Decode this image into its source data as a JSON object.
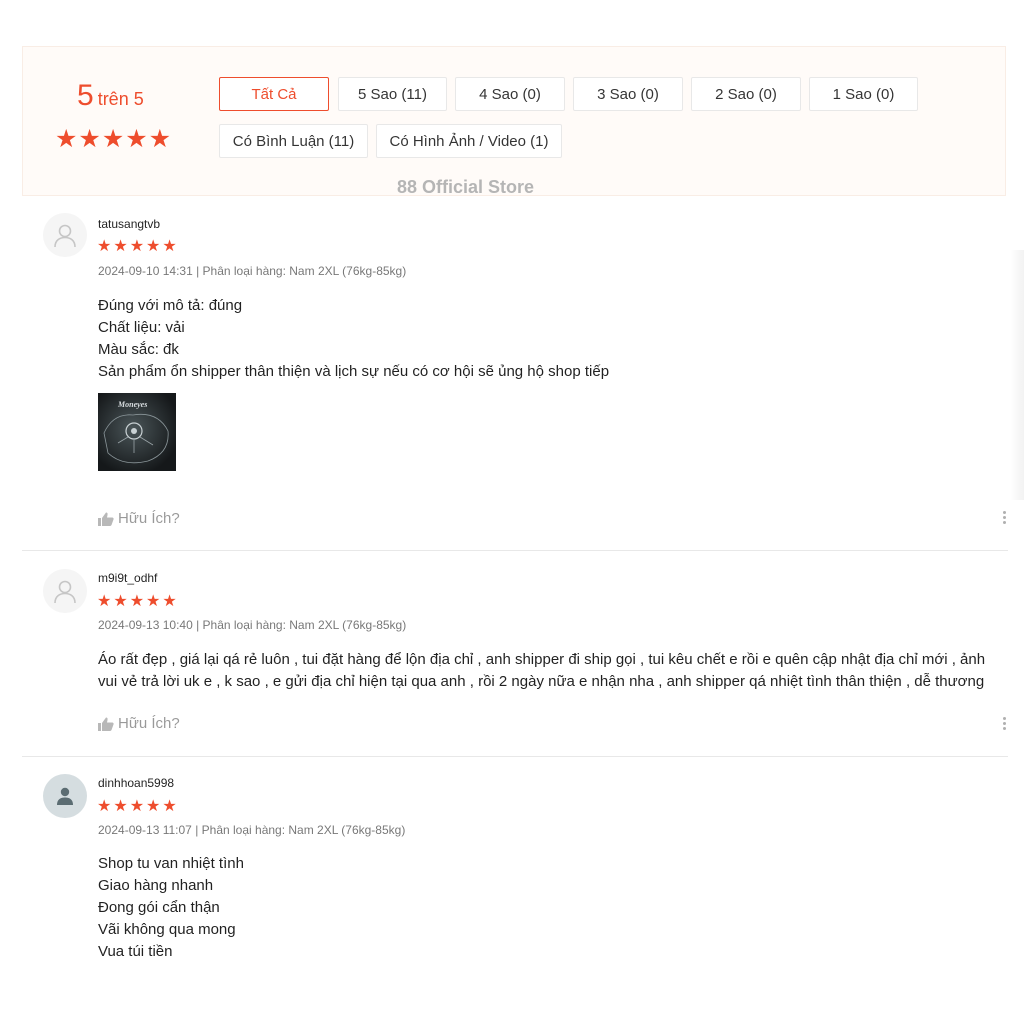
{
  "summary": {
    "score": "5",
    "score_suffix": "trên 5",
    "stars": "★★★★★",
    "watermark": "88 Official Store",
    "accent_color": "#ee4d2d"
  },
  "filters": [
    {
      "label": "Tất Cả",
      "active": true
    },
    {
      "label": "5 Sao (11)",
      "active": false
    },
    {
      "label": "4 Sao (0)",
      "active": false
    },
    {
      "label": "3 Sao (0)",
      "active": false
    },
    {
      "label": "2 Sao (0)",
      "active": false
    },
    {
      "label": "1 Sao (0)",
      "active": false
    },
    {
      "label": "Có Bình Luận (11)",
      "active": false
    },
    {
      "label": "Có Hình Ảnh / Video (1)",
      "active": false
    }
  ],
  "reviews": [
    {
      "username": "tatusangtvb",
      "rating": 5,
      "stars": "★★★★★",
      "meta": "2024-09-10 14:31 | Phân loại hàng: Nam 2XL (76kg-85kg)",
      "lines": [
        "Đúng với mô tả: đúng",
        "Chất liệu: vải",
        "Màu sắc: đk",
        "Sản phẩm ổn shipper thân thiện và lịch sự nếu có cơ hội sẽ ủng hộ shop tiếp"
      ],
      "image_text": "Moneyes",
      "helpful_label": "Hữu Ích?"
    },
    {
      "username": "m9i9t_odhf",
      "rating": 5,
      "stars": "★★★★★",
      "meta": "2024-09-13 10:40 | Phân loại hàng: Nam 2XL (76kg-85kg)",
      "lines": [
        "Áo rất đẹp , giá lại qá rẻ luôn , tui đặt hàng để lộn địa chỉ , anh shipper đi ship gọi , tui kêu chết e rồi e quên cập nhật địa chỉ mới , ảnh",
        "vui vẻ trả lời uk e , k sao , e gửi địa chỉ hiện tại qua anh , rồi 2 ngày nữa e nhận nha , anh shipper qá nhiệt tình thân thiện , dễ thương"
      ],
      "helpful_label": "Hữu Ích?"
    },
    {
      "username": "dinhhoan5998",
      "rating": 5,
      "stars": "★★★★★",
      "meta": "2024-09-13 11:07 | Phân loại hàng: Nam 2XL (76kg-85kg)",
      "lines": [
        "Shop tu van nhiệt tình",
        "Giao hàng nhanh",
        "Đong gói cẩn thận",
        "Vãi không qua mong",
        "Vua túi tiền"
      ]
    }
  ]
}
